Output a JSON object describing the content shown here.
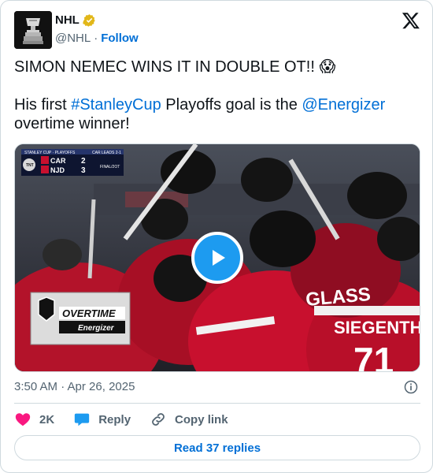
{
  "author": {
    "name": "NHL",
    "handle": "@NHL",
    "separator": "·",
    "follow_label": "Follow"
  },
  "tweet": {
    "line1": "SIMON NEMEC WINS IT IN DOUBLE OT!! 😱",
    "line2_prefix": "His first ",
    "hashtag": "#StanleyCup",
    "line2_middle": " Playoffs goal is the ",
    "mention": "@Energizer",
    "line2_suffix": " overtime winner!"
  },
  "scorebug": {
    "tag": "STANLEY CUP · PLAYOFFS",
    "status": "CAR LEADS 2-1",
    "team1": "CAR",
    "score1": "2",
    "team2": "NJD",
    "score2": "3",
    "period": "FINAL/2OT"
  },
  "overlay": {
    "title": "OVERTIME",
    "sponsor": "Energizer"
  },
  "jerseys": {
    "player1": "GLASS",
    "player2": "SIEGENTHALER",
    "number": "71"
  },
  "timestamp": "3:50 AM · Apr 26, 2025",
  "actions": {
    "likes": "2K",
    "reply": "Reply",
    "copy": "Copy link"
  },
  "read_replies": "Read 37 replies",
  "colors": {
    "link": "#006fd6",
    "like": "#f91880",
    "reply_bubble": "#1d9bf0",
    "devils_red": "#c8102e"
  }
}
